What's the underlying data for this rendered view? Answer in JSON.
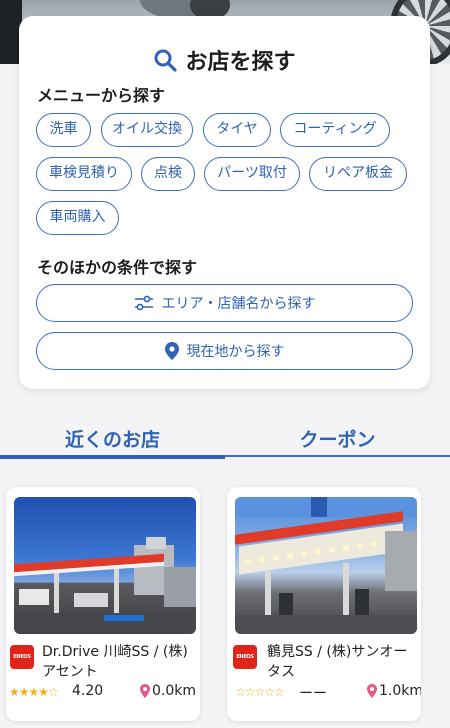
{
  "search": {
    "title": "お店を探す",
    "menu_section_label": "メニューから探す",
    "menu_chips": [
      "洗車",
      "オイル交換",
      "タイヤ",
      "コーティング",
      "車検見積り",
      "点検",
      "パーツ取付",
      "リペア板金",
      "車両購入"
    ],
    "other_section_label": "そのほかの条件で探す",
    "area_button_label": "エリア・店舗名から探す",
    "location_button_label": "現在地から探す"
  },
  "tabs": {
    "nearby_label": "近くのお店",
    "coupon_label": "クーポン",
    "active": "nearby"
  },
  "stores": [
    {
      "brand": "ENEOS",
      "name": "Dr.Drive 川崎SS / (株)アセント",
      "stars_text": "★★★★☆",
      "rating": "4.20",
      "distance": "0.0km"
    },
    {
      "brand": "ENEOS",
      "name": "鶴見SS / (株)サンオータス",
      "stars_text": "☆☆☆☆☆",
      "rating": "ーー",
      "distance": "1.0km"
    }
  ],
  "colors": {
    "accent": "#2f62b5",
    "star": "#f2b01e",
    "pin": "#e8578a",
    "brand_red": "#e2231a"
  },
  "icons": {
    "title": "search-icon",
    "area_button": "sliders-icon",
    "location_button": "location-pin-icon",
    "distance": "map-pin-icon"
  }
}
